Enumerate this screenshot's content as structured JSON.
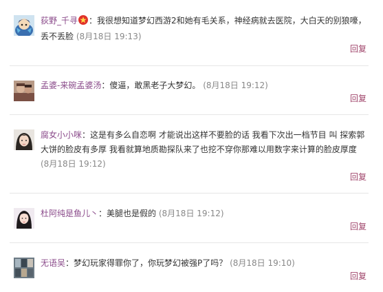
{
  "comments": [
    {
      "user": "荻野_千寻",
      "has_star": true,
      "text": "：我很想知道梦幻西游2和她有毛关系，神经病就去医院，大白天的别狼嚎，丢不丢脸",
      "time": "(8月18日 19:13)",
      "reply": "回复"
    },
    {
      "user": "孟婆-来碗孟婆汤",
      "has_star": false,
      "text": "：傻逼，敢黑老子大梦幻。",
      "time": "(8月18日 19:12)",
      "reply": "回复"
    },
    {
      "user": "腐女小小咪",
      "has_star": false,
      "text": "：这是有多么自恋啊 才能说出这样不要脸的话 我看下次出一档节目 叫 探索郭大饼的脸皮有多厚 我看就算地质勘探队来了也挖不穿你那难以用数字来计算的脸皮厚度",
      "time": "(8月18日 19:12)",
      "reply": "回复"
    },
    {
      "user": "杜阿纯是鱼儿丶",
      "has_star": false,
      "text": "：美腿也是假的",
      "time": "(8月18日 19:12)",
      "reply": "回复"
    },
    {
      "user": "无语吴",
      "has_star": false,
      "text": "：梦幻玩家得罪你了，你玩梦幻被强P了吗？",
      "time": "(8月18日 19:10)",
      "reply": "回复"
    }
  ],
  "colors": {
    "username": "#8a4a8a",
    "timestamp": "#888888",
    "reply_link": "#a0456b",
    "separator": "#e6e6e6",
    "star_badge": "#e0322b"
  },
  "icons": {
    "badge": "red-star-icon"
  }
}
